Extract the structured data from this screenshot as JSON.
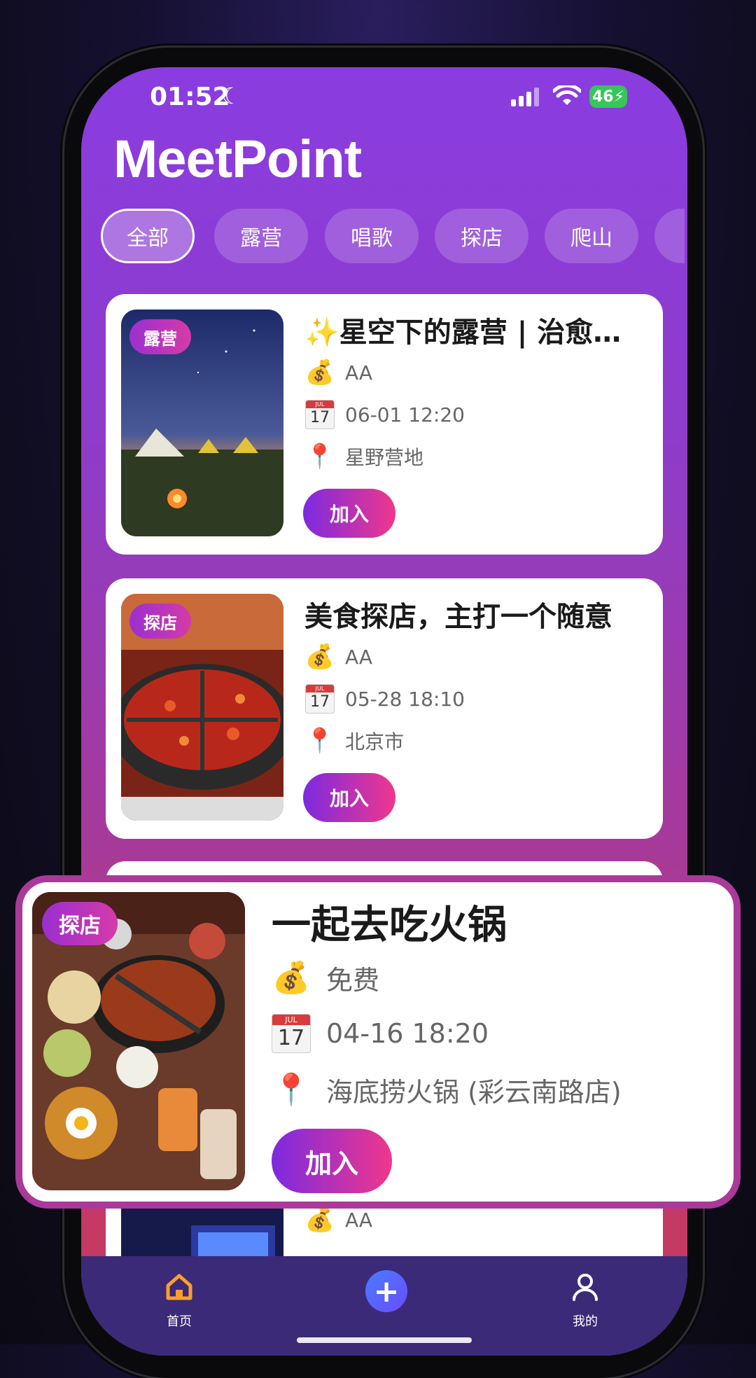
{
  "status": {
    "time": "01:52",
    "battery": "46"
  },
  "app": {
    "title": "MeetPoint"
  },
  "chips": [
    "全部",
    "露营",
    "唱歌",
    "探店",
    "爬山",
    ""
  ],
  "cards": [
    {
      "tag": "露营",
      "title": "✨星空下的露营 | 治愈…",
      "cost": "AA",
      "datetime": "06-01 12:20",
      "location": "星野营地",
      "join": "加入"
    },
    {
      "tag": "探店",
      "title": "美食探店，主打一个随意",
      "cost": "AA",
      "datetime": "05-28 18:10",
      "location": "北京市",
      "join": "加入"
    },
    {
      "cost": "AA"
    }
  ],
  "highlight_card": {
    "tag": "探店",
    "title": "一起去吃火锅",
    "cost": "免费",
    "datetime": "04-16 18:20",
    "location": "海底捞火锅 (彩云南路店)",
    "join": "加入"
  },
  "calendar": {
    "month": "JUL",
    "day": "17"
  },
  "tabbar": {
    "home": "首页",
    "mine": "我的",
    "add": "+"
  },
  "colors": {
    "accent": "#8a3ce0",
    "join_gradient_start": "#7c2ae0",
    "join_gradient_end": "#f0378c",
    "highlight_border": "#a93a9a"
  }
}
